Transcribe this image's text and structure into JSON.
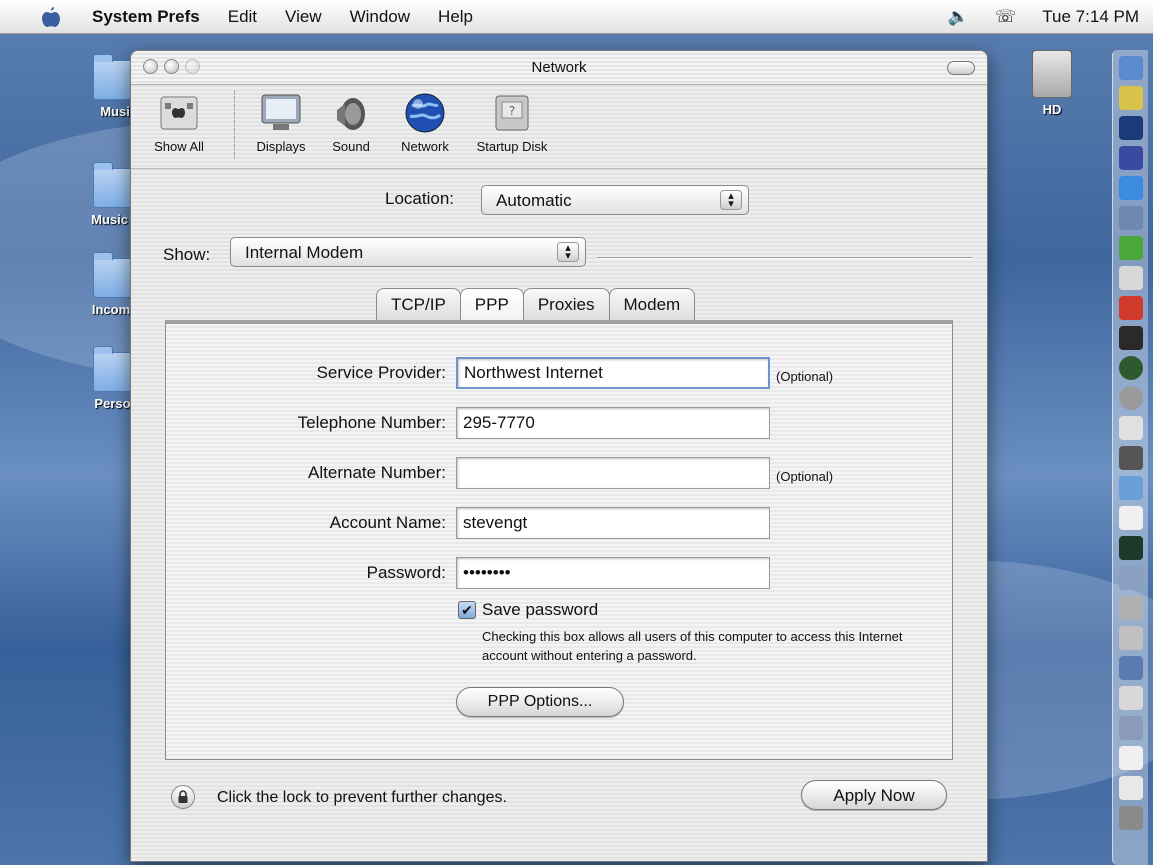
{
  "menubar": {
    "app_name": "System Prefs",
    "items": [
      "Edit",
      "View",
      "Window",
      "Help"
    ],
    "clock": "Tue 7:14 PM"
  },
  "desktop": {
    "icons": [
      "Musi",
      "Music a",
      "Incomp",
      "Persor"
    ],
    "hd_label": "HD"
  },
  "window": {
    "title": "Network",
    "toolbar": {
      "show_all": "Show All",
      "items": [
        "Displays",
        "Sound",
        "Network",
        "Startup Disk"
      ]
    },
    "location": {
      "label": "Location:",
      "value": "Automatic"
    },
    "show": {
      "label": "Show:",
      "value": "Internal Modem"
    },
    "tabs": [
      "TCP/IP",
      "PPP",
      "Proxies",
      "Modem"
    ],
    "active_tab": "PPP",
    "form": {
      "service_provider": {
        "label": "Service Provider:",
        "value": "Northwest Internet",
        "note": "(Optional)"
      },
      "telephone_number": {
        "label": "Telephone Number:",
        "value": "295-7770"
      },
      "alternate_number": {
        "label": "Alternate Number:",
        "value": "",
        "note": "(Optional)"
      },
      "account_name": {
        "label": "Account Name:",
        "value": "stevengt"
      },
      "password": {
        "label": "Password:",
        "value": "••••••••"
      },
      "save_password": {
        "label": "Save password",
        "checked": true,
        "help": "Checking this box allows all users of this computer to access this Internet account without entering a password."
      },
      "ppp_options_button": "PPP Options..."
    },
    "footer": {
      "lock_text": "Click the lock to prevent further changes.",
      "apply_button": "Apply Now"
    }
  },
  "colors": {
    "desktop_blue": "#4d75aa",
    "focus_ring": "#6d95c9",
    "checkbox_blue": "#7fa9dd"
  }
}
